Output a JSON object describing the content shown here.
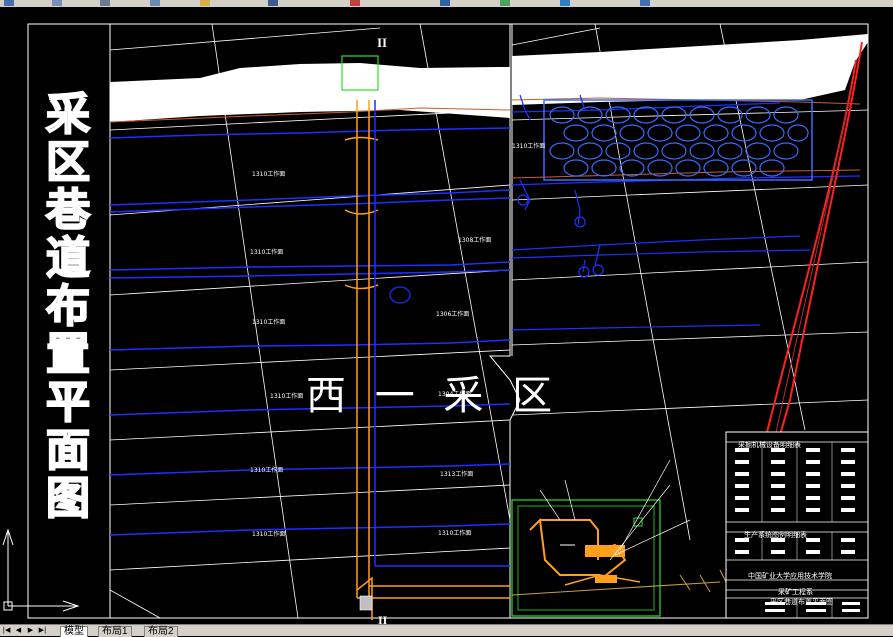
{
  "drawing": {
    "vertical_title_chars": [
      "采",
      "区",
      "巷",
      "道",
      "布",
      "置",
      "平",
      "面",
      "图"
    ],
    "area_label": "西 一 采 区",
    "section_label_top": "II",
    "section_label_bottom": "II",
    "tunnel_labels": [
      "1310工作面",
      "1310工作面",
      "1308工作面",
      "1310工作面",
      "1310工作面",
      "1306工作面",
      "1310工作面",
      "1310工作面",
      "1310工作面",
      "1304工作面",
      "1313工作面",
      "1310工作面"
    ],
    "colors": {
      "background": "#000000",
      "frame": "#ffffff",
      "roadway_blue": "#1e2fff",
      "shaft_orange": "#ff9f1a",
      "boundary_red": "#ff2020",
      "highlight_green": "#28e028",
      "pillar_blue": "#3a6bff"
    }
  },
  "legend": {
    "header1": "采掘机械设备明细表",
    "header2": "生产系统图例明细表",
    "school": "中国矿业大学应用技术学院",
    "dept": "采矿工程系",
    "title_block": "采区巷道布置平面图"
  },
  "tabs": {
    "model": "模型",
    "layout1": "布局1",
    "layout2": "布局2"
  },
  "ucs": {
    "x_label": "X",
    "y_label": "Y"
  }
}
